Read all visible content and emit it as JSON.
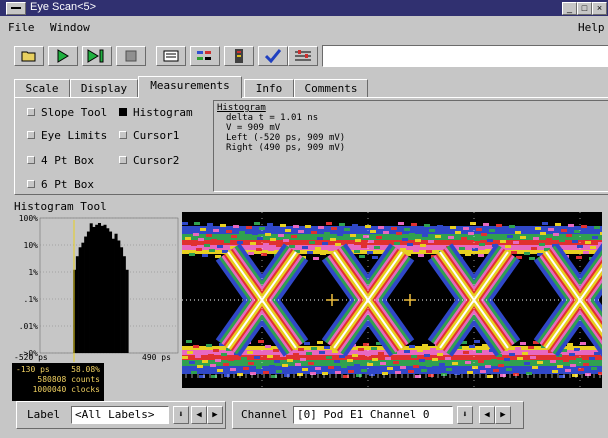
{
  "window": {
    "title": "Eye Scan<5>",
    "sys_icon": "system-menu-icon",
    "min_glyph": "_",
    "max_glyph": "□",
    "close_glyph": "×"
  },
  "menu": {
    "file": "File",
    "window": "Window",
    "help": "Help"
  },
  "toolbar": {
    "buttons": [
      {
        "name": "open-folder-icon"
      },
      {
        "name": "run-icon"
      },
      {
        "name": "run-repetitive-icon"
      },
      {
        "name": "stop-icon"
      },
      {
        "name": "notepad-icon"
      },
      {
        "name": "markers-icon"
      },
      {
        "name": "hardware-icon"
      },
      {
        "name": "check-icon"
      },
      {
        "name": "properties-icon"
      }
    ],
    "command_value": ""
  },
  "tabs": [
    "Scale",
    "Display",
    "Measurements",
    "Info",
    "Comments"
  ],
  "active_tab": "Measurements",
  "options": {
    "slope_tool": {
      "label": "Slope Tool",
      "checked": false
    },
    "histogram": {
      "label": "Histogram",
      "checked": true
    },
    "eye_limits": {
      "label": "Eye Limits",
      "checked": false
    },
    "cursor1": {
      "label": "Cursor1",
      "checked": false
    },
    "pt4_box": {
      "label": "4 Pt Box",
      "checked": false
    },
    "cursor2": {
      "label": "Cursor2",
      "checked": false
    },
    "pt6_box": {
      "label": "6 Pt Box",
      "checked": false
    }
  },
  "measurements": {
    "heading": "Histogram",
    "lines": [
      "delta t = 1.01 ns",
      "V = 909 mV",
      "Left (-520 ps, 909 mV)",
      "Right (490 ps, 909 mV)"
    ]
  },
  "histogram_tool": {
    "title": "Histogram Tool",
    "y_ticks": [
      "100%",
      "10%",
      "1%",
      ".1%",
      ".01%",
      ">0%"
    ],
    "x_left": "-520 ps",
    "x_right": "490 ps",
    "readout": {
      "time": "-130 ps",
      "percent": "58.08%",
      "counts": "580808 counts",
      "clocks": "1000040 clocks"
    },
    "colors": {
      "bars": "#000000",
      "marker": "#e8d020"
    }
  },
  "chart_data": {
    "type": "bar",
    "xlabel": "",
    "ylabel": "",
    "y_scale": "log",
    "x_range_ps": [
      -520,
      490
    ],
    "categories": [
      "-490",
      "-470",
      "-450",
      "-430",
      "-410",
      "-390",
      "-370",
      "-350",
      "-330",
      "-310",
      "-290",
      "-270",
      "-250",
      "-230",
      "-210",
      "-190",
      "-170",
      "-150",
      "-130",
      "-110",
      "-90",
      "-70",
      "-50",
      "-30",
      "-10",
      "10",
      "30",
      "50",
      "70",
      "90",
      "110",
      "130",
      "150",
      "170",
      "190",
      "210",
      "230",
      "250",
      "270",
      "290",
      "310",
      "330",
      "350",
      "370",
      "390",
      "410",
      "430",
      "450",
      "470",
      "490"
    ],
    "values": [
      0,
      0,
      0,
      0,
      0,
      0,
      0,
      0,
      0,
      0,
      0,
      0,
      0.5,
      2,
      5,
      8,
      15,
      25,
      58,
      40,
      50,
      60,
      45,
      50,
      35,
      25,
      12,
      20,
      10,
      5,
      2,
      0.5,
      0,
      0,
      0,
      0,
      0,
      0,
      0,
      0,
      0,
      0,
      0,
      0,
      0,
      0,
      0,
      0,
      0,
      0
    ]
  },
  "eye_diagram": {
    "colors": {
      "background": "#000000",
      "outer": "#3048c8",
      "mid": "#30a050",
      "inner1": "#e03030",
      "inner2": "#e868c0",
      "core": "#e8d020",
      "hot": "#ffffff",
      "grid": "#ffffff",
      "marker": "#f0c040"
    }
  },
  "bottom": {
    "label_caption": "Label",
    "label_value": "<All Labels>",
    "channel_caption": "Channel",
    "channel_value": "[0] Pod E1 Channel 0",
    "down_glyph": "⬇",
    "left_glyph": "◀",
    "right_glyph": "▶"
  }
}
